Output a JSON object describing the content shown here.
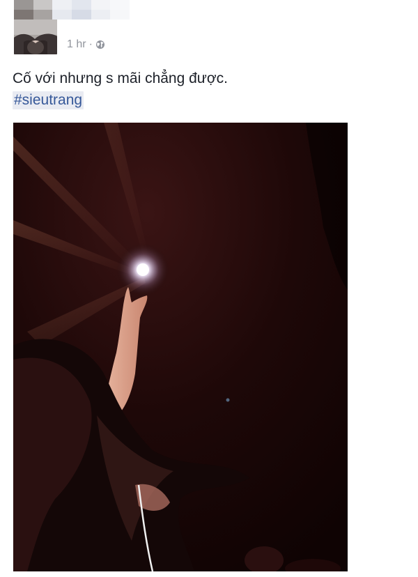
{
  "post": {
    "timestamp": "1 hr",
    "separator": "·",
    "privacy_icon": "globe-icon",
    "text": "Cố với nhưng s mãi chẳng được.",
    "hashtag": "#sieutrang"
  },
  "colors": {
    "text": "#1d2129",
    "meta": "#90949c",
    "hashtag_text": "#365899",
    "hashtag_bg": "#e9ebf2"
  }
}
